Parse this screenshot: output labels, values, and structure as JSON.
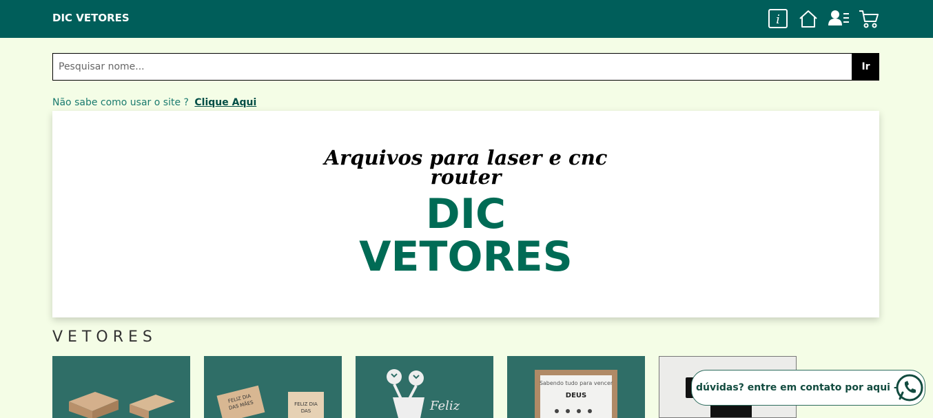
{
  "header": {
    "brand": "DIC VETORES",
    "icons": [
      "info-icon",
      "home-icon",
      "user-profile-icon",
      "cart-icon"
    ],
    "color": "#005e5a"
  },
  "search": {
    "placeholder": "Pesquisar nome...",
    "value": "",
    "button_label": "Ir"
  },
  "help": {
    "text": "Não sabe como usar o site ?",
    "link": "Clique Aqui"
  },
  "banner": {
    "tagline_line1": "Arquivos para laser e cnc",
    "tagline_line2": "router",
    "title_line1": "DIC",
    "title_line2": "VETORES",
    "accent": "#006b55"
  },
  "section": {
    "title": "VETORES"
  },
  "products": [
    {
      "image": "wooden-box-image"
    },
    {
      "image": "mothers-day-wood-image"
    },
    {
      "image": "flower-vase-image"
    },
    {
      "image": "wall-frame-image"
    },
    {
      "image": "black-frame-image"
    }
  ],
  "contact": {
    "text": "dúvidas? entre em contato por aqui ->",
    "icon": "whatsapp-icon"
  }
}
